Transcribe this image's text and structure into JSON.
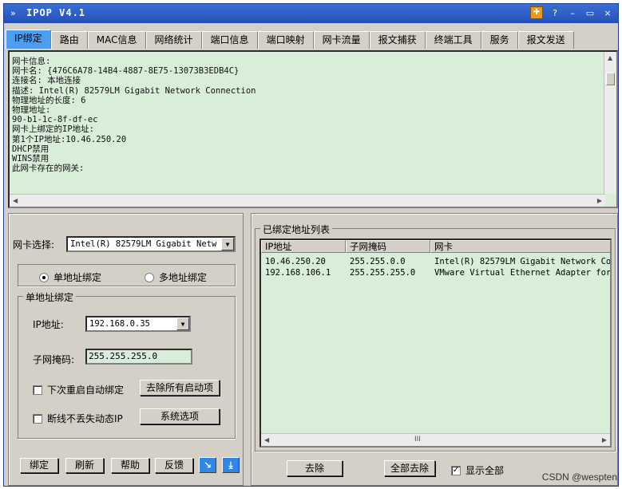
{
  "window": {
    "title": "IPOP V4.1",
    "pin_icon": "pin-icon",
    "help": "?",
    "minimize": "–",
    "maximize": "▭",
    "close": "×"
  },
  "tabs": [
    {
      "label": "IP绑定",
      "active": true
    },
    {
      "label": "路由"
    },
    {
      "label": "MAC信息"
    },
    {
      "label": "网络统计"
    },
    {
      "label": "端口信息"
    },
    {
      "label": "端口映射"
    },
    {
      "label": "网卡流量"
    },
    {
      "label": "报文捕获"
    },
    {
      "label": "终端工具"
    },
    {
      "label": "服务"
    },
    {
      "label": "报文发送"
    }
  ],
  "info": {
    "lines": [
      "网卡信息:",
      "网卡名: {476C6A78-14B4-4887-8E75-13073B3EDB4C}",
      "连接名: 本地连接",
      "描述: Intel(R) 82579LM Gigabit Network Connection",
      "物理地址的长度: 6",
      "物理地址:",
      "90-b1-1c-8f-df-ec",
      "网卡上绑定的IP地址:",
      "第1个IP地址:10.46.250.20",
      "DHCP禁用",
      "WINS禁用",
      "此网卡存在的网关:"
    ]
  },
  "left": {
    "nic_label": "网卡选择:",
    "nic_value": "Intel(R) 82579LM Gigabit Netw",
    "single_bind_radio": "单地址绑定",
    "multi_bind_radio": "多地址绑定",
    "group_title": "单地址绑定",
    "ip_label": "IP地址:",
    "ip_value": "192.168.0.35",
    "mask_label": "子网掩码:",
    "mask_value": "255.255.255.0",
    "auto_bind_check": "下次重启自动绑定",
    "remove_startup_button": "去除所有启动项",
    "keep_dynamic_check": "断线不丢失动态IP",
    "system_options_button": "系统选项",
    "bind_button": "绑定",
    "refresh_button": "刷新",
    "help_button": "帮助",
    "feedback_button": "反馈",
    "icon1": "arrow-down-right-icon",
    "icon2": "download-icon"
  },
  "right": {
    "group_title": "已绑定地址列表",
    "columns": [
      "IP地址",
      "子网掩码",
      "网卡"
    ],
    "rows": [
      [
        "10.46.250.20",
        "255.255.0.0",
        "Intel(R) 82579LM Gigabit Network Co"
      ],
      [
        "192.168.106.1",
        "255.255.255.0",
        "VMware Virtual Ethernet Adapter for"
      ]
    ],
    "scroll_grip": "III",
    "remove_button": "去除",
    "remove_all_button": "全部去除",
    "show_all_check": "显示全部"
  },
  "watermark": "CSDN @wespten"
}
